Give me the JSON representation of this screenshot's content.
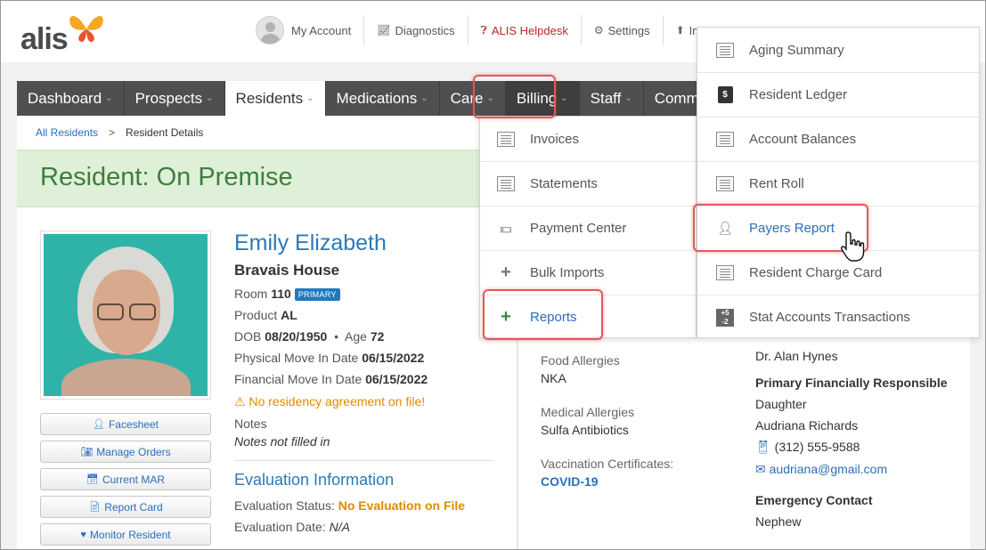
{
  "logo": {
    "text": "alis"
  },
  "topbar": {
    "account": "My Account",
    "diagnostics": "Diagnostics",
    "helpdesk": "ALIS Helpdesk",
    "settings": "Settings",
    "imports": "Imp"
  },
  "nav": {
    "items": [
      "Dashboard",
      "Prospects",
      "Residents",
      "Medications",
      "Care",
      "Billing",
      "Staff",
      "Communitie"
    ]
  },
  "breadcrumb": {
    "root": "All Residents",
    "sep": ">",
    "current": "Resident Details"
  },
  "page": {
    "title": "Resident: On Premise"
  },
  "resident": {
    "name": "Emily Elizabeth",
    "house": "Bravais House",
    "room_label": "Room",
    "room": "110",
    "room_badge": "PRIMARY",
    "product_label": "Product",
    "product": "AL",
    "dob_label": "DOB",
    "dob": "08/20/1950",
    "age_label": "Age",
    "age": "72",
    "physical_move_label": "Physical Move In Date",
    "physical_move": "06/15/2022",
    "financial_move_label": "Financial Move In Date",
    "financial_move": "06/15/2022",
    "warning": "No residency agreement on file!",
    "notes_label": "Notes",
    "notes": "Notes not filled in"
  },
  "actions": [
    "Facesheet",
    "Manage Orders",
    "Current MAR",
    "Report Card",
    "Monitor Resident"
  ],
  "evaluation": {
    "title": "Evaluation Information",
    "status_label": "Evaluation Status:",
    "status": "No Evaluation on File",
    "date_label": "Evaluation Date:",
    "date": "N/A"
  },
  "medical": {
    "food_label": "Food Allergies",
    "food": "NKA",
    "med_label": "Medical Allergies",
    "med": "Sulfa Antibiotics",
    "vac_label": "Vaccination Certificates:",
    "vac": "COVID-19"
  },
  "contacts": {
    "physician": "Dr. Alan Hynes",
    "pfr_title": "Primary Financially Responsible",
    "pfr_relation": "Daughter",
    "pfr_name": "Audriana Richards",
    "pfr_phone": "(312) 555-9588",
    "pfr_email": "audriana@gmail.com",
    "emergency_title": "Emergency Contact",
    "emergency_relation": "Nephew"
  },
  "billing_menu": [
    "Invoices",
    "Statements",
    "Payment Center",
    "Bulk Imports",
    "Reports"
  ],
  "reports_menu": [
    "Aging Summary",
    "Resident Ledger",
    "Account Balances",
    "Rent Roll",
    "Payers Report",
    "Resident Charge Card",
    "Stat Accounts Transactions"
  ],
  "colors": {
    "highlight": "#e05a5a",
    "link": "#2a6ebb",
    "nav_bg": "#4f4f4f",
    "title_band": "#dff0d8"
  }
}
